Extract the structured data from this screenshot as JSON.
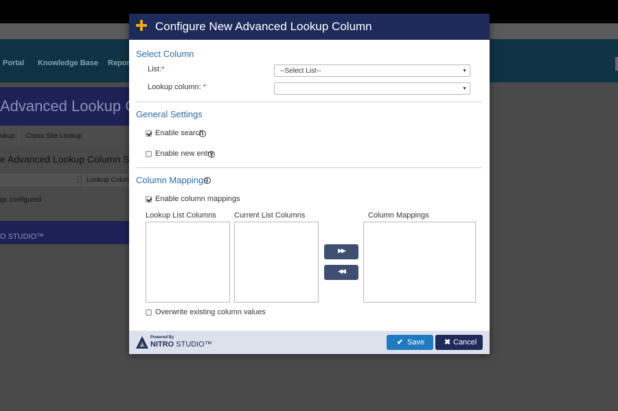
{
  "background": {
    "nav_items": [
      "Portal",
      "Knowledge Base",
      "Repor"
    ],
    "page_title": "Advanced Lookup C",
    "tabs": [
      "okup",
      "Cross Site Lookup"
    ],
    "subtitle": "e Advanced Lookup Column S",
    "grid_column": "Lookup Colum",
    "empty_text": "gs configured",
    "footer_logo": "O STUDIO™"
  },
  "modal": {
    "title": "Configure New Advanced Lookup Column",
    "select_column": {
      "heading": "Select Column",
      "list_label": "List:",
      "list_value": "--Select List--",
      "lookup_label": "Lookup column:",
      "lookup_value": "",
      "required_mark": "*"
    },
    "general_settings": {
      "heading": "General Settings",
      "enable_search": "Enable search",
      "enable_new_entry": "Enable new entry"
    },
    "column_mappings": {
      "heading": "Column Mappings",
      "enable_mappings": "Enable column mappings",
      "lookup_list_columns": "Lookup List Columns",
      "current_list_columns": "Current List Columns",
      "column_mappings_label": "Column Mappings",
      "add_symbol": "▶▶",
      "remove_symbol": "◀◀",
      "overwrite": "Overwrite existing column values"
    },
    "info_symbol": "i",
    "footer": {
      "powered_by": "Powered By",
      "brand_bold": "NITRO",
      "brand_rest": " STUDIO™",
      "save_label": "Save",
      "cancel_label": "Cancel",
      "save_icon": "✔",
      "cancel_icon": "✖"
    },
    "colors": {
      "header": "#1e2a5a",
      "accent": "#f2a81d",
      "section_title": "#2b6aa8",
      "save_button": "#1f7bc1"
    }
  }
}
